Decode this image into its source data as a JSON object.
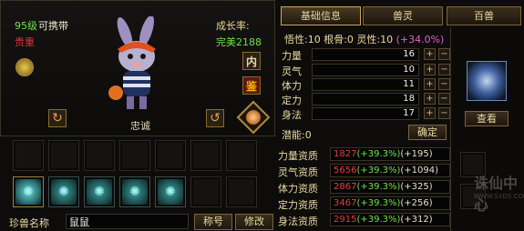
{
  "pet": {
    "level": "95级",
    "carry": "可携带",
    "rarity": "贵重",
    "growth_label": "成长率:",
    "growth_value": "完美2188",
    "character": "忠诚",
    "inner_button": "内",
    "appraise_button": "鉴"
  },
  "tabs": [
    "基础信息",
    "兽灵",
    "百兽"
  ],
  "wuxing": {
    "text": "悟性:10  根骨:0  灵性:10",
    "bonus": "(+34.0%)"
  },
  "stats": [
    {
      "label": "力量",
      "value": "16"
    },
    {
      "label": "灵气",
      "value": "10"
    },
    {
      "label": "体力",
      "value": "11"
    },
    {
      "label": "定力",
      "value": "18"
    },
    {
      "label": "身法",
      "value": "17"
    }
  ],
  "potential": "潜能:0",
  "confirm_label": "确定",
  "aptitudes": [
    {
      "label": "力量资质",
      "base": "1827",
      "pct": "(+39.3%)",
      "bonus": "(+195)"
    },
    {
      "label": "灵气资质",
      "base": "5656",
      "pct": "(+39.3%)",
      "bonus": "(+1094)"
    },
    {
      "label": "体力资质",
      "base": "2867",
      "pct": "(+39.3%)",
      "bonus": "(+325)"
    },
    {
      "label": "定力资质",
      "base": "3467",
      "pct": "(+39.3%)",
      "bonus": "(+256)"
    },
    {
      "label": "身法资质",
      "base": "2915",
      "pct": "(+39.3%)",
      "bonus": "(+312)"
    }
  ],
  "name_label": "珍兽名称",
  "name_value": "鼠鼠",
  "title_button": "称号",
  "modify_button": "修改",
  "view_button": "查看",
  "watermark": "诛仙中心",
  "watermark_url": "WWW.SXDS.COM",
  "slot_icons": [
    "swirl-icon",
    "swirl-icon",
    "swirl-icon",
    "swirl-icon",
    "swirl-icon"
  ],
  "colors": {
    "green": "#6ee04a",
    "red": "#e04040",
    "gold": "#e8d8a0"
  }
}
